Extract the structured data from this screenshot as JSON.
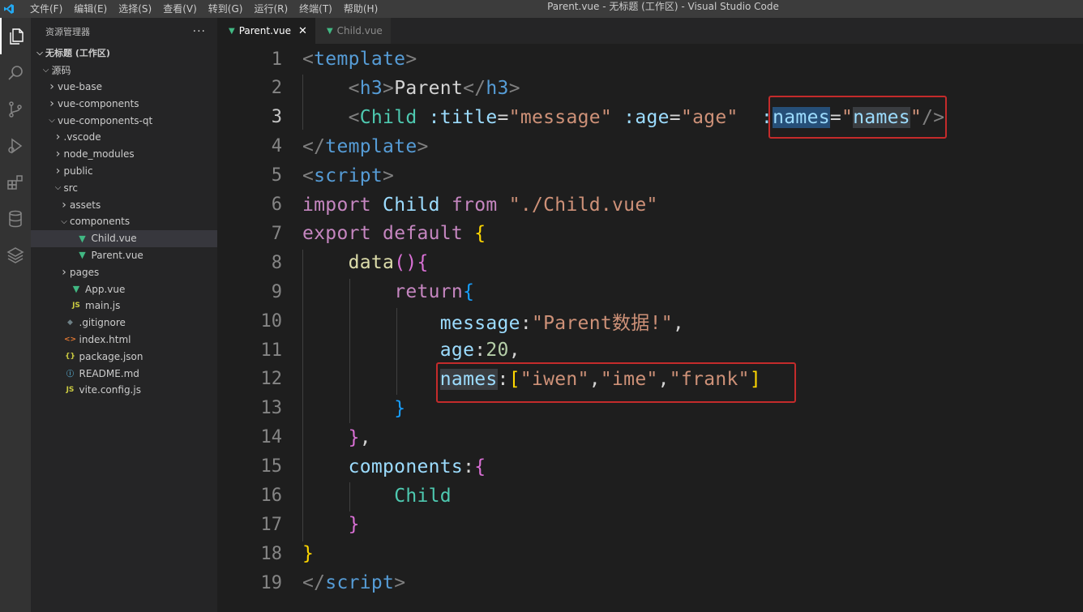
{
  "titlebar": {
    "menu": [
      "文件(F)",
      "编辑(E)",
      "选择(S)",
      "查看(V)",
      "转到(G)",
      "运行(R)",
      "终端(T)",
      "帮助(H)"
    ],
    "window_title": "Parent.vue - 无标题 (工作区) - Visual Studio Code"
  },
  "activity_icons": [
    "files-icon",
    "search-icon",
    "source-control-icon",
    "run-debug-icon",
    "extensions-icon",
    "database-icon",
    "layers-icon"
  ],
  "sidebar": {
    "title": "资源管理器",
    "more": "···",
    "tree": [
      {
        "label": "无标题 (工作区)",
        "indent": 0,
        "chev": "v",
        "icon": "",
        "bold": true
      },
      {
        "label": "源码",
        "indent": 1,
        "chev": "v",
        "icon": ""
      },
      {
        "label": "vue-base",
        "indent": 2,
        "chev": ">",
        "icon": ""
      },
      {
        "label": "vue-components",
        "indent": 2,
        "chev": ">",
        "icon": ""
      },
      {
        "label": "vue-components-qt",
        "indent": 2,
        "chev": "v",
        "icon": ""
      },
      {
        "label": ".vscode",
        "indent": 3,
        "chev": ">",
        "icon": ""
      },
      {
        "label": "node_modules",
        "indent": 3,
        "chev": ">",
        "icon": ""
      },
      {
        "label": "public",
        "indent": 3,
        "chev": ">",
        "icon": ""
      },
      {
        "label": "src",
        "indent": 3,
        "chev": "v",
        "icon": ""
      },
      {
        "label": "assets",
        "indent": 4,
        "chev": ">",
        "icon": ""
      },
      {
        "label": "components",
        "indent": 4,
        "chev": "v",
        "icon": ""
      },
      {
        "label": "Child.vue",
        "indent": 5,
        "chev": "",
        "icon": "vue",
        "selected": true
      },
      {
        "label": "Parent.vue",
        "indent": 5,
        "chev": "",
        "icon": "vue"
      },
      {
        "label": "pages",
        "indent": 4,
        "chev": ">",
        "icon": ""
      },
      {
        "label": "App.vue",
        "indent": 4,
        "chev": "",
        "icon": "vue"
      },
      {
        "label": "main.js",
        "indent": 4,
        "chev": "",
        "icon": "js"
      },
      {
        "label": ".gitignore",
        "indent": 3,
        "chev": "",
        "icon": "git"
      },
      {
        "label": "index.html",
        "indent": 3,
        "chev": "",
        "icon": "html"
      },
      {
        "label": "package.json",
        "indent": 3,
        "chev": "",
        "icon": "json"
      },
      {
        "label": "README.md",
        "indent": 3,
        "chev": "",
        "icon": "info"
      },
      {
        "label": "vite.config.js",
        "indent": 3,
        "chev": "",
        "icon": "js"
      }
    ]
  },
  "tabs": [
    {
      "label": "Parent.vue",
      "active": true,
      "close": "✕"
    },
    {
      "label": "Child.vue",
      "active": false
    }
  ],
  "editor": {
    "current_line": 3,
    "lines": [
      {
        "n": "1",
        "tokens": [
          [
            "punct",
            "<"
          ],
          [
            "tag",
            "template"
          ],
          [
            "punct",
            ">"
          ]
        ]
      },
      {
        "n": "2",
        "tokens": [
          [
            "text",
            "    "
          ],
          [
            "punct",
            "<"
          ],
          [
            "tag",
            "h3"
          ],
          [
            "punct",
            ">"
          ],
          [
            "text",
            "Parent"
          ],
          [
            "punct",
            "</"
          ],
          [
            "tag",
            "h3"
          ],
          [
            "punct",
            ">"
          ]
        ]
      },
      {
        "n": "3",
        "tokens": [
          [
            "text",
            "    "
          ],
          [
            "punct",
            "<"
          ],
          [
            "type",
            "Child"
          ],
          [
            "text",
            " "
          ],
          [
            "attr",
            ":title"
          ],
          [
            "text",
            "="
          ],
          [
            "str",
            "\"message\""
          ],
          [
            "text",
            " "
          ],
          [
            "attr",
            ":age"
          ],
          [
            "text",
            "="
          ],
          [
            "str",
            "\"age\""
          ],
          [
            "text",
            " "
          ],
          [
            "attr",
            " :"
          ],
          [
            "attr-sel",
            "names"
          ],
          [
            "text",
            "="
          ],
          [
            "str",
            "\""
          ],
          [
            "attr-word",
            "names"
          ],
          [
            "str",
            "\""
          ],
          [
            "punct",
            "/>"
          ]
        ]
      },
      {
        "n": "4",
        "tokens": [
          [
            "punct",
            "</"
          ],
          [
            "tag",
            "template"
          ],
          [
            "punct",
            ">"
          ]
        ]
      },
      {
        "n": "5",
        "tokens": [
          [
            "punct",
            "<"
          ],
          [
            "tag",
            "script"
          ],
          [
            "punct",
            ">"
          ]
        ]
      },
      {
        "n": "6",
        "tokens": [
          [
            "kw",
            "import"
          ],
          [
            "text",
            " "
          ],
          [
            "prop",
            "Child"
          ],
          [
            "text",
            " "
          ],
          [
            "kw",
            "from"
          ],
          [
            "text",
            " "
          ],
          [
            "str",
            "\"./Child.vue\""
          ]
        ]
      },
      {
        "n": "7",
        "tokens": [
          [
            "kw",
            "export"
          ],
          [
            "text",
            " "
          ],
          [
            "kw",
            "default"
          ],
          [
            "text",
            " "
          ],
          [
            "brace1",
            "{"
          ]
        ]
      },
      {
        "n": "8",
        "tokens": [
          [
            "text",
            "    "
          ],
          [
            "fn",
            "data"
          ],
          [
            "brace2",
            "()"
          ],
          [
            "brace2",
            "{"
          ]
        ]
      },
      {
        "n": "9",
        "tokens": [
          [
            "text",
            "        "
          ],
          [
            "kw",
            "return"
          ],
          [
            "brace3",
            "{"
          ]
        ]
      },
      {
        "n": "10",
        "tokens": [
          [
            "text",
            "            "
          ],
          [
            "prop",
            "message"
          ],
          [
            "text",
            ":"
          ],
          [
            "str",
            "\"Parent数据!\""
          ],
          [
            "text",
            ","
          ]
        ]
      },
      {
        "n": "11",
        "tokens": [
          [
            "text",
            "            "
          ],
          [
            "prop",
            "age"
          ],
          [
            "text",
            ":"
          ],
          [
            "num",
            "20"
          ],
          [
            "text",
            ","
          ]
        ]
      },
      {
        "n": "12",
        "tokens": [
          [
            "text",
            "            "
          ],
          [
            "prop-word",
            "names"
          ],
          [
            "text",
            ":"
          ],
          [
            "brace1",
            "["
          ],
          [
            "str",
            "\"iwen\""
          ],
          [
            "text",
            ","
          ],
          [
            "str",
            "\"ime\""
          ],
          [
            "text",
            ","
          ],
          [
            "str",
            "\"frank\""
          ],
          [
            "brace1",
            "]"
          ]
        ]
      },
      {
        "n": "13",
        "tokens": [
          [
            "text",
            "        "
          ],
          [
            "brace3",
            "}"
          ]
        ]
      },
      {
        "n": "14",
        "tokens": [
          [
            "text",
            "    "
          ],
          [
            "brace2",
            "}"
          ],
          [
            "text",
            ","
          ]
        ]
      },
      {
        "n": "15",
        "tokens": [
          [
            "text",
            "    "
          ],
          [
            "prop",
            "components"
          ],
          [
            "text",
            ":"
          ],
          [
            "brace2",
            "{"
          ]
        ]
      },
      {
        "n": "16",
        "tokens": [
          [
            "text",
            "        "
          ],
          [
            "type",
            "Child"
          ]
        ]
      },
      {
        "n": "17",
        "tokens": [
          [
            "text",
            "    "
          ],
          [
            "brace2",
            "}"
          ]
        ]
      },
      {
        "n": "18",
        "tokens": [
          [
            "brace1",
            "}"
          ]
        ]
      },
      {
        "n": "19",
        "tokens": [
          [
            "punct",
            "</"
          ],
          [
            "tag",
            "script"
          ],
          [
            "punct",
            ">"
          ]
        ]
      }
    ]
  }
}
